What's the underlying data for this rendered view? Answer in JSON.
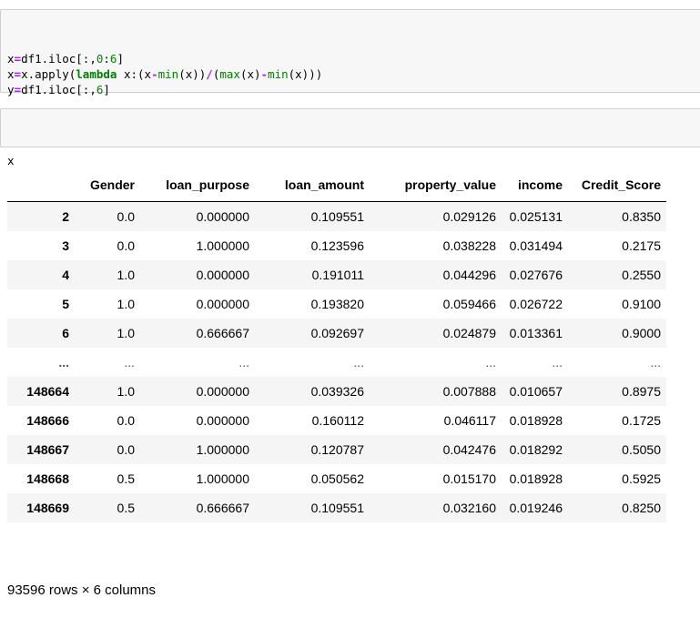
{
  "cells": {
    "code1": [
      [
        {
          "t": "x",
          "c": "var"
        },
        {
          "t": "=",
          "c": "op"
        },
        {
          "t": "df1.iloc[:,",
          "c": "var"
        },
        {
          "t": "0",
          "c": "num"
        },
        {
          "t": ":",
          "c": "var"
        },
        {
          "t": "6",
          "c": "num"
        },
        {
          "t": "]",
          "c": "var"
        }
      ],
      [
        {
          "t": "x",
          "c": "var"
        },
        {
          "t": "=",
          "c": "op"
        },
        {
          "t": "x.apply(",
          "c": "var"
        },
        {
          "t": "lambda",
          "c": "kw"
        },
        {
          "t": " x:(x",
          "c": "var"
        },
        {
          "t": "-",
          "c": "op"
        },
        {
          "t": "min",
          "c": "fn"
        },
        {
          "t": "(x))",
          "c": "var"
        },
        {
          "t": "/",
          "c": "op"
        },
        {
          "t": "(",
          "c": "var"
        },
        {
          "t": "max",
          "c": "fn"
        },
        {
          "t": "(x)",
          "c": "var"
        },
        {
          "t": "-",
          "c": "op"
        },
        {
          "t": "min",
          "c": "fn"
        },
        {
          "t": "(x)))",
          "c": "var"
        }
      ],
      [
        {
          "t": "y",
          "c": "var"
        },
        {
          "t": "=",
          "c": "op"
        },
        {
          "t": "df1.iloc[:,",
          "c": "var"
        },
        {
          "t": "6",
          "c": "num"
        },
        {
          "t": "]",
          "c": "var"
        }
      ]
    ],
    "code2": [
      [
        {
          "t": "x",
          "c": "var"
        }
      ]
    ]
  },
  "table": {
    "columns": [
      "Gender",
      "loan_purpose",
      "loan_amount",
      "property_value",
      "income",
      "Credit_Score"
    ],
    "rows": [
      {
        "index": "2",
        "values": [
          "0.0",
          "0.000000",
          "0.109551",
          "0.029126",
          "0.025131",
          "0.8350"
        ]
      },
      {
        "index": "3",
        "values": [
          "0.0",
          "1.000000",
          "0.123596",
          "0.038228",
          "0.031494",
          "0.2175"
        ]
      },
      {
        "index": "4",
        "values": [
          "1.0",
          "0.000000",
          "0.191011",
          "0.044296",
          "0.027676",
          "0.2550"
        ]
      },
      {
        "index": "5",
        "values": [
          "1.0",
          "0.000000",
          "0.193820",
          "0.059466",
          "0.026722",
          "0.9100"
        ]
      },
      {
        "index": "6",
        "values": [
          "1.0",
          "0.666667",
          "0.092697",
          "0.024879",
          "0.013361",
          "0.9000"
        ]
      },
      {
        "index": "...",
        "values": [
          "...",
          "...",
          "...",
          "...",
          "...",
          "..."
        ],
        "ellipsis": true
      },
      {
        "index": "148664",
        "values": [
          "1.0",
          "0.000000",
          "0.039326",
          "0.007888",
          "0.010657",
          "0.8975"
        ]
      },
      {
        "index": "148666",
        "values": [
          "0.0",
          "0.000000",
          "0.160112",
          "0.046117",
          "0.018928",
          "0.1725"
        ]
      },
      {
        "index": "148667",
        "values": [
          "0.0",
          "1.000000",
          "0.120787",
          "0.042476",
          "0.018292",
          "0.5050"
        ]
      },
      {
        "index": "148668",
        "values": [
          "0.5",
          "1.000000",
          "0.050562",
          "0.015170",
          "0.018928",
          "0.5925"
        ]
      },
      {
        "index": "148669",
        "values": [
          "0.5",
          "0.666667",
          "0.109551",
          "0.032160",
          "0.019246",
          "0.8250"
        ]
      }
    ]
  },
  "summary": "93596 rows × 6 columns",
  "colors": {
    "cell_background": "#f7f7f7",
    "cell_border": "#cfcfcf",
    "operator": "#aa22ff",
    "keyword": "#008000",
    "number": "#008800",
    "row_stripe": "#f5f5f5"
  }
}
